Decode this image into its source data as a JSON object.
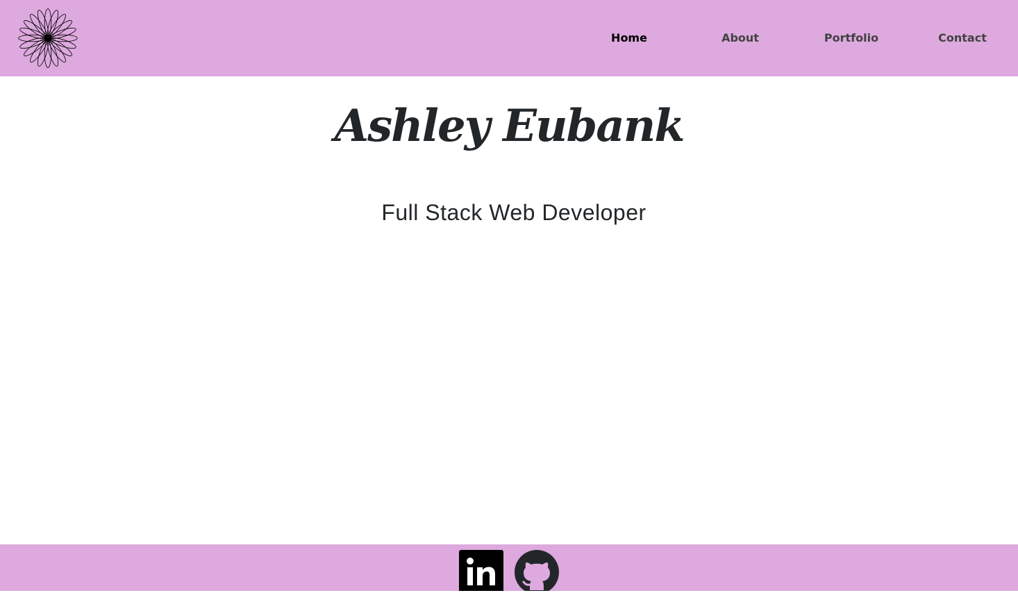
{
  "header": {
    "logo_icon": "daisy-flower-icon",
    "nav": [
      {
        "label": "Home",
        "active": true
      },
      {
        "label": "About",
        "active": false
      },
      {
        "label": "Portfolio",
        "active": false
      },
      {
        "label": "Contact",
        "active": false
      }
    ]
  },
  "hero": {
    "name": "Ashley Eubank",
    "role": "Full Stack Web Developer"
  },
  "footer": {
    "links": [
      {
        "icon": "linkedin-icon"
      },
      {
        "icon": "github-icon"
      }
    ]
  },
  "colors": {
    "header_bg": "#dda9de",
    "footer_bg": "#dda9de",
    "text": "#222629",
    "nav_text": "#424242",
    "nav_active": "#000000"
  }
}
